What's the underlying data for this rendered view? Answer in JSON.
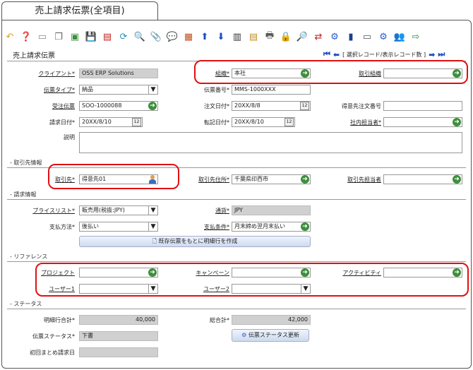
{
  "window": {
    "tab_title": "売上請求伝票(全項目)",
    "page_title": "売上請求伝票"
  },
  "toolbar": {
    "icons": [
      "undo-icon",
      "help-icon",
      "new-icon",
      "copy-icon",
      "delete-icon",
      "save-icon",
      "save-new-icon",
      "refresh-icon",
      "find-icon",
      "attach-icon",
      "chat-icon",
      "grid-icon",
      "up-icon",
      "down-icon",
      "history-icon",
      "report-icon",
      "print-icon",
      "lock-icon",
      "zoom-icon",
      "move-icon",
      "workflow-icon",
      "archive-icon",
      "product-icon",
      "gear-icon",
      "people-icon",
      "export-icon"
    ]
  },
  "record_nav": {
    "first": "⏮",
    "prev": "⬅",
    "text": "[ 選択レコード/表示レコード数 ]",
    "next": "➡",
    "last": "⏭"
  },
  "fields": {
    "client_label": "クライアント*",
    "client": "OSS ERP Solutions",
    "org_label": "組織*",
    "org": "本社",
    "trade_org_label": "取引組織",
    "trade_org": "",
    "doc_type_label": "伝票タイプ*",
    "doc_type": "納品",
    "doc_no_label": "伝票番号*",
    "doc_no": "MMS-1000XXX",
    "order_label": "受注伝票",
    "order": "SOO-1000088",
    "order_date_label": "注文日付*",
    "order_date": "20XX/8/8",
    "cust_order_label": "得意先注文番号",
    "cust_order": "",
    "inv_date_label": "請求日付*",
    "inv_date": "20XX/8/10",
    "acct_date_label": "転記日付*",
    "acct_date": "20XX/8/10",
    "sales_rep_label": "社内担当者*",
    "sales_rep": "",
    "desc_label": "説明",
    "desc": ""
  },
  "sections": {
    "partner": "- 取引先情報",
    "invoice": "- 請求情報",
    "reference": "- リファレンス",
    "status": "- ステータス"
  },
  "partner": {
    "bp_label": "取引先*",
    "bp": "得意先01",
    "bp_loc_label": "取引先住所*",
    "bp_loc": "千葉県印西市",
    "bp_contact_label": "取引先担当者",
    "bp_contact": ""
  },
  "invoice": {
    "pricelist_label": "プライスリスト*",
    "pricelist": "販売用(税抜:JPY)",
    "currency_label": "通貨*",
    "currency": "JPY",
    "payrule_label": "支払方法*",
    "payrule": "後払い",
    "payterm_label": "支払条件*",
    "payterm": "月末締め翌月末払い",
    "copy_btn": "既存伝票をもとに明細行を作成"
  },
  "reference": {
    "project_label": "プロジェクト",
    "project": "",
    "campaign_label": "キャンペーン",
    "campaign": "",
    "activity_label": "アクティビティ",
    "activity": "",
    "user1_label": "ユーザー1",
    "user1": "",
    "user2_label": "ユーザー2",
    "user2": ""
  },
  "status": {
    "line_total_label": "明細行合計*",
    "line_total": "40,000",
    "grand_total_label": "総合計*",
    "grand_total": "42,000",
    "doc_status_label": "伝票ステータス*",
    "doc_status": "下書",
    "doc_status_btn": "伝票ステータス更新",
    "first_inv_label": "初回まとめ請求日",
    "first_inv": ""
  }
}
